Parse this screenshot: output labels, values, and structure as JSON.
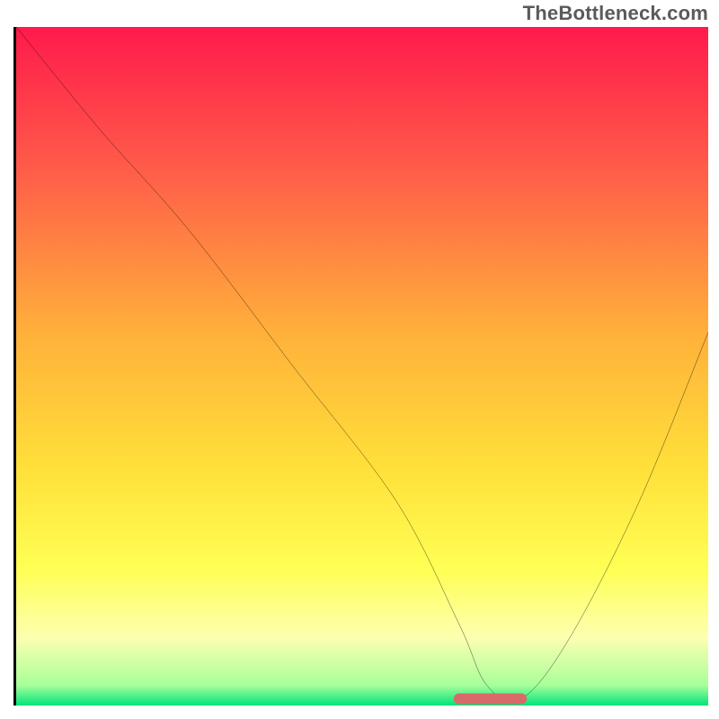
{
  "watermark": "TheBottleneck.com",
  "chart_data": {
    "type": "line",
    "title": "",
    "xlabel": "",
    "ylabel": "",
    "xlim": [
      0,
      100
    ],
    "ylim": [
      0,
      100
    ],
    "grid": false,
    "background_gradient_stops": [
      {
        "offset": 0.0,
        "color": "#ff1a4b"
      },
      {
        "offset": 0.2,
        "color": "#ff594a"
      },
      {
        "offset": 0.45,
        "color": "#ffb03a"
      },
      {
        "offset": 0.65,
        "color": "#ffe03a"
      },
      {
        "offset": 0.8,
        "color": "#ffff55"
      },
      {
        "offset": 0.9,
        "color": "#fdffb0"
      },
      {
        "offset": 0.97,
        "color": "#a8ff9a"
      },
      {
        "offset": 1.0,
        "color": "#00e47a"
      }
    ],
    "series": [
      {
        "name": "bottleneck-curve",
        "color": "#000000",
        "x": [
          0,
          12,
          25,
          40,
          55,
          64,
          68,
          73,
          80,
          90,
          100
        ],
        "y": [
          100,
          85,
          70,
          50,
          30,
          12,
          3,
          1,
          10,
          30,
          55
        ]
      }
    ],
    "marker": {
      "name": "optimal-range",
      "color": "#d96a6a",
      "x_start": 64,
      "x_end": 73,
      "y": 1,
      "thickness": 2.5
    }
  }
}
